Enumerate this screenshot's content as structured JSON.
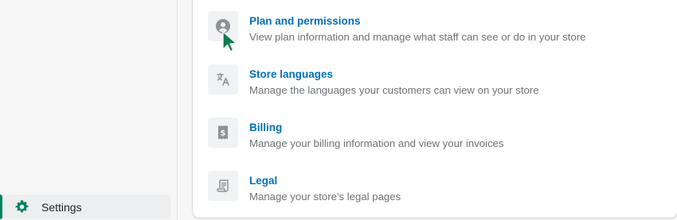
{
  "sidebar": {
    "settings_label": "Settings"
  },
  "settings_list": [
    {
      "title": "Plan and permissions",
      "description": "View plan information and manage what staff can see or do in your store",
      "icon": "user-icon"
    },
    {
      "title": "Store languages",
      "description": "Manage the languages your customers can view on your store",
      "icon": "translate-icon"
    },
    {
      "title": "Billing",
      "description": "Manage your billing information and view your invoices",
      "icon": "invoice-dollar-icon"
    },
    {
      "title": "Legal",
      "description": "Manage your store's legal pages",
      "icon": "legal-document-icon"
    }
  ],
  "colors": {
    "link": "#006fbb",
    "accent": "#008060",
    "icon": "#8c9196"
  }
}
